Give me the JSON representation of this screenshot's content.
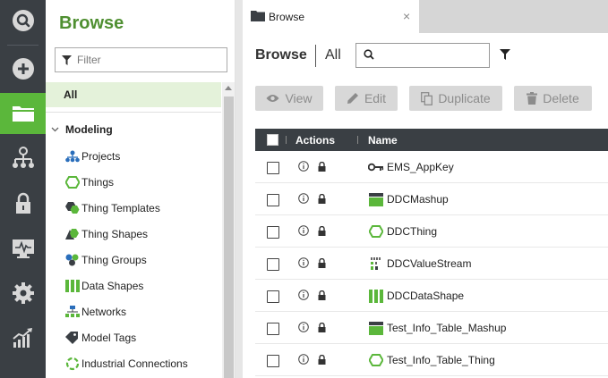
{
  "rail": {
    "items": [
      {
        "icon": "search-icon"
      },
      {
        "icon": "plus-icon"
      },
      {
        "icon": "folder-icon",
        "active": true
      },
      {
        "icon": "hierarchy-icon"
      },
      {
        "icon": "lock-icon"
      },
      {
        "icon": "monitor-icon"
      },
      {
        "icon": "gear-icon"
      },
      {
        "icon": "analytics-icon"
      }
    ],
    "active_color": "#5bb73b",
    "background": "#3a3f44"
  },
  "panel": {
    "title": "Browse",
    "filter_placeholder": "Filter",
    "all_label": "All",
    "section_label": "Modeling",
    "items": [
      {
        "label": "Projects",
        "icon": "projects-icon"
      },
      {
        "label": "Things",
        "icon": "thing-hexagon-icon"
      },
      {
        "label": "Thing Templates",
        "icon": "thing-template-icon"
      },
      {
        "label": "Thing Shapes",
        "icon": "thing-shape-icon"
      },
      {
        "label": "Thing Groups",
        "icon": "thing-group-icon"
      },
      {
        "label": "Data Shapes",
        "icon": "data-shape-icon"
      },
      {
        "label": "Networks",
        "icon": "network-icon"
      },
      {
        "label": "Model Tags",
        "icon": "tag-icon"
      },
      {
        "label": "Industrial Connections",
        "icon": "industrial-connection-icon"
      }
    ]
  },
  "main": {
    "tab_label": "Browse",
    "tab_close": "×",
    "title": "Browse",
    "scope": "All",
    "search_value": "",
    "buttons": {
      "view": "View",
      "edit": "Edit",
      "duplicate": "Duplicate",
      "delete": "Delete"
    },
    "columns": {
      "actions": "Actions",
      "name": "Name"
    },
    "rows": [
      {
        "name": "EMS_AppKey",
        "icon": "key-icon"
      },
      {
        "name": "DDCMashup",
        "icon": "mashup-icon"
      },
      {
        "name": "DDCThing",
        "icon": "thing-hexagon-icon"
      },
      {
        "name": "DDCValueStream",
        "icon": "value-stream-icon"
      },
      {
        "name": "DDCDataShape",
        "icon": "data-shape-icon"
      },
      {
        "name": "Test_Info_Table_Mashup",
        "icon": "mashup-icon"
      },
      {
        "name": "Test_Info_Table_Thing",
        "icon": "thing-hexagon-icon"
      }
    ]
  },
  "colors": {
    "brand_green": "#5bb73b",
    "title_green": "#4f8f31",
    "selected_bg": "#e4f2da",
    "header_dark": "#3a3f44"
  }
}
